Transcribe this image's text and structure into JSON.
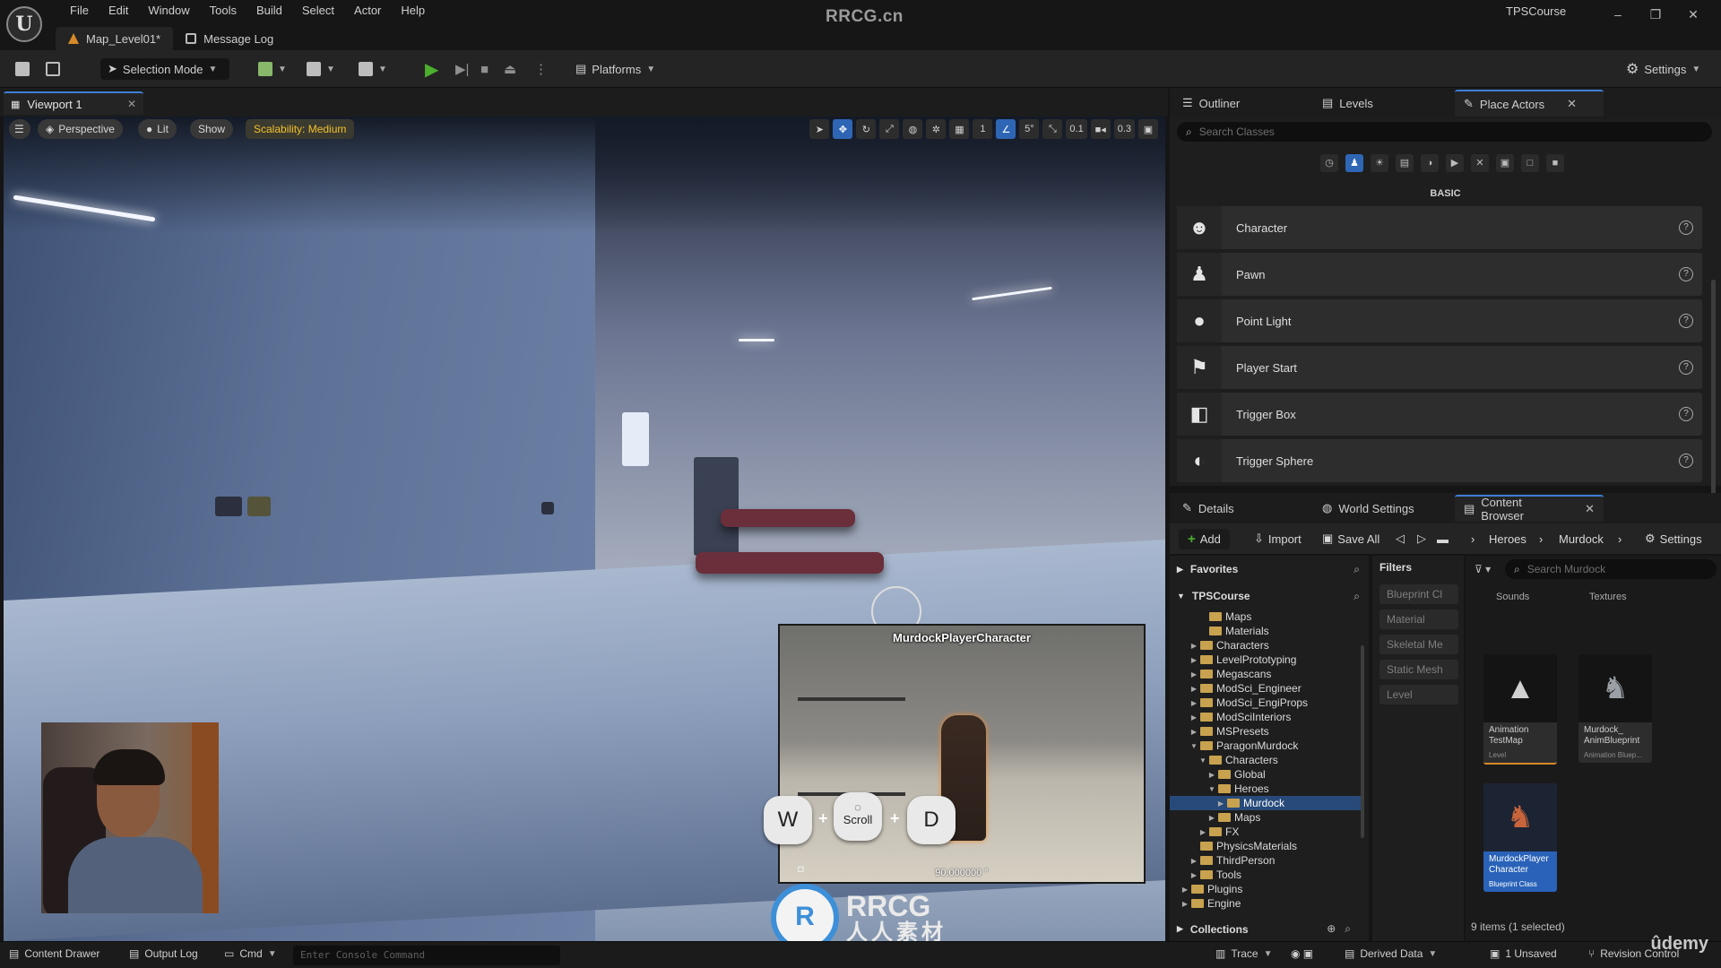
{
  "menubar": {
    "items": [
      "File",
      "Edit",
      "Window",
      "Tools",
      "Build",
      "Select",
      "Actor",
      "Help"
    ],
    "site_title": "RRCG.cn",
    "project_name": "TPSCourse",
    "window_controls": [
      "–",
      "❐",
      "✕"
    ]
  },
  "doc_tabs": [
    {
      "label": "Map_Level01*"
    },
    {
      "label": "Message Log"
    }
  ],
  "toolbar": {
    "mode_label": "Selection Mode",
    "platforms_label": "Platforms",
    "settings_label": "Settings"
  },
  "viewport": {
    "tab_label": "Viewport 1",
    "perspective_label": "Perspective",
    "lit_label": "Lit",
    "show_label": "Show",
    "scalability_label": "Scalability: Medium",
    "grid_value": "1",
    "angle_value": "5°",
    "scale_value": "0.1",
    "camera_speed": "0.3"
  },
  "preview": {
    "title": "MurdockPlayerCharacter",
    "readout": "90.000000 °"
  },
  "key_overlay": {
    "key1": "W",
    "key2": "Scroll",
    "key3": "D",
    "plus": "+"
  },
  "watermark": {
    "line1": "RRCG",
    "line2": "人人素材",
    "circle": "R"
  },
  "place_actors": {
    "tabs": [
      "Outliner",
      "Levels",
      "Place Actors"
    ],
    "search_placeholder": "Search Classes",
    "category_heading": "BASIC",
    "items": [
      {
        "label": "Character",
        "icon": "character-icon"
      },
      {
        "label": "Pawn",
        "icon": "pawn-icon"
      },
      {
        "label": "Point Light",
        "icon": "point-light-icon"
      },
      {
        "label": "Player Start",
        "icon": "player-start-icon"
      },
      {
        "label": "Trigger Box",
        "icon": "trigger-box-icon"
      },
      {
        "label": "Trigger Sphere",
        "icon": "trigger-sphere-icon"
      }
    ]
  },
  "content_browser": {
    "tabs": [
      "Details",
      "World Settings",
      "Content Browser"
    ],
    "add_label": "Add",
    "import_label": "Import",
    "save_all_label": "Save All",
    "breadcrumb": [
      "Heroes",
      "Murdock"
    ],
    "settings_label": "Settings",
    "favorites_label": "Favorites",
    "root_label": "TPSCourse",
    "tree": [
      {
        "label": "Maps",
        "depth": 3,
        "arrow": ""
      },
      {
        "label": "Materials",
        "depth": 3,
        "arrow": ""
      },
      {
        "label": "Characters",
        "depth": 2,
        "arrow": "▶"
      },
      {
        "label": "LevelPrototyping",
        "depth": 2,
        "arrow": "▶"
      },
      {
        "label": "Megascans",
        "depth": 2,
        "arrow": "▶"
      },
      {
        "label": "ModSci_Engineer",
        "depth": 2,
        "arrow": "▶"
      },
      {
        "label": "ModSci_EngiProps",
        "depth": 2,
        "arrow": "▶"
      },
      {
        "label": "ModSciInteriors",
        "depth": 2,
        "arrow": "▶"
      },
      {
        "label": "MSPresets",
        "depth": 2,
        "arrow": "▶"
      },
      {
        "label": "ParagonMurdock",
        "depth": 2,
        "arrow": "▼"
      },
      {
        "label": "Characters",
        "depth": 3,
        "arrow": "▼"
      },
      {
        "label": "Global",
        "depth": 4,
        "arrow": "▶"
      },
      {
        "label": "Heroes",
        "depth": 4,
        "arrow": "▼"
      },
      {
        "label": "Murdock",
        "depth": 5,
        "arrow": "▶",
        "selected": true
      },
      {
        "label": "Maps",
        "depth": 4,
        "arrow": "▶"
      },
      {
        "label": "FX",
        "depth": 3,
        "arrow": "▶"
      },
      {
        "label": "PhysicsMaterials",
        "depth": 2,
        "arrow": ""
      },
      {
        "label": "ThirdPerson",
        "depth": 2,
        "arrow": "▶"
      },
      {
        "label": "Tools",
        "depth": 2,
        "arrow": "▶"
      },
      {
        "label": "Plugins",
        "depth": 1,
        "arrow": "▶"
      },
      {
        "label": "Engine",
        "depth": 1,
        "arrow": "▶"
      }
    ],
    "collections_label": "Collections",
    "filters_heading": "Filters",
    "filters": [
      "Blueprint Cl",
      "Material",
      "Skeletal Me",
      "Static Mesh",
      "Level"
    ],
    "asset_search_placeholder": "Search Murdock",
    "columns": [
      "Sounds",
      "Textures"
    ],
    "assets": [
      {
        "name": "Animation TestMap",
        "type": "Level"
      },
      {
        "name": "Murdock_ AnimBlueprint",
        "type": "Animation Bluep..."
      },
      {
        "name": "MurdockPlayer Character",
        "type": "Blueprint Class"
      }
    ],
    "item_count": "9 items (1 selected)"
  },
  "statusbar": {
    "content_drawer": "Content Drawer",
    "output_log": "Output Log",
    "cmd": "Cmd",
    "console_placeholder": "Enter Console Command",
    "trace": "Trace",
    "derived_data": "Derived Data",
    "unsaved": "1 Unsaved",
    "revision_control": "Revision Control"
  },
  "udemy_label": "ûdemy",
  "colors": {
    "accent_blue": "#2e66b5",
    "play_green": "#4caf2e",
    "scalability_yellow": "#f0c12c",
    "folder": "#c8a24e"
  }
}
